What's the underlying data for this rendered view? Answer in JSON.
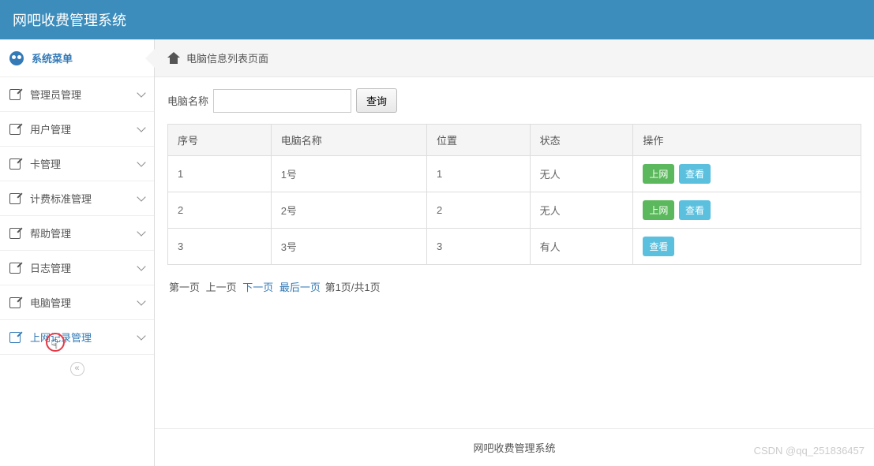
{
  "header": {
    "title": "网吧收费管理系统"
  },
  "sidebar": {
    "menu_header": "系统菜单",
    "items": [
      {
        "label": "管理员管理"
      },
      {
        "label": "用户管理"
      },
      {
        "label": "卡管理"
      },
      {
        "label": "计费标准管理"
      },
      {
        "label": "帮助管理"
      },
      {
        "label": "日志管理"
      },
      {
        "label": "电脑管理"
      },
      {
        "label": "上网记录管理"
      }
    ]
  },
  "breadcrumb": {
    "title": "电脑信息列表页面"
  },
  "search": {
    "label": "电脑名称",
    "value": "",
    "placeholder": "",
    "button": "查询"
  },
  "table": {
    "headers": [
      "序号",
      "电脑名称",
      "位置",
      "状态",
      "操作"
    ],
    "rows": [
      {
        "id": "1",
        "name": "1号",
        "pos": "1",
        "status": "无人",
        "actions": [
          "上网",
          "查看"
        ]
      },
      {
        "id": "2",
        "name": "2号",
        "pos": "2",
        "status": "无人",
        "actions": [
          "上网",
          "查看"
        ]
      },
      {
        "id": "3",
        "name": "3号",
        "pos": "3",
        "status": "有人",
        "actions": [
          "查看"
        ]
      }
    ]
  },
  "pagination": {
    "first": "第一页",
    "prev": "上一页",
    "next": "下一页",
    "last": "最后一页",
    "info": "第1页/共1页"
  },
  "footer": {
    "text": "网吧收费管理系统"
  },
  "watermark": "CSDN @qq_251836457"
}
